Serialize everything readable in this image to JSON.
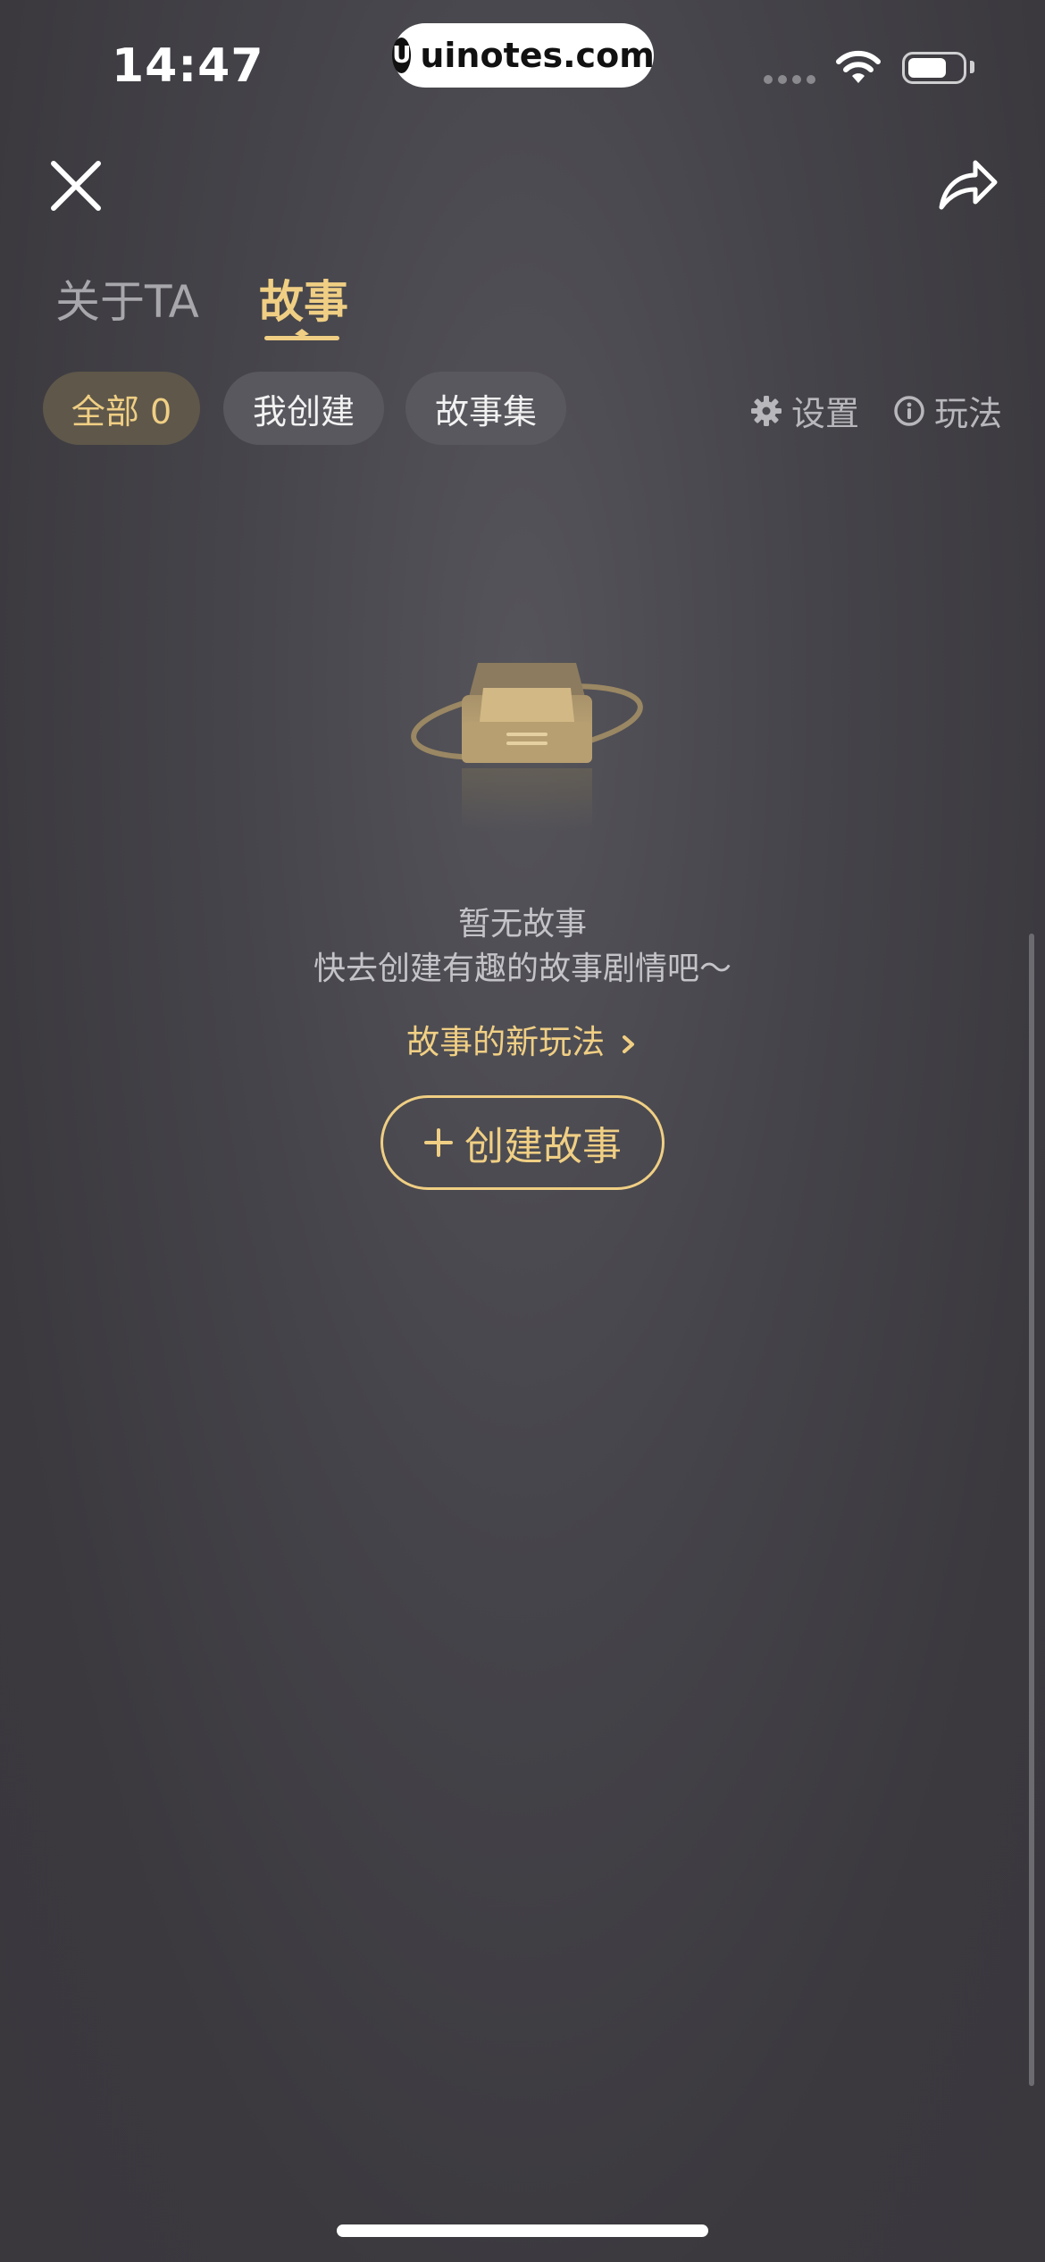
{
  "status_bar": {
    "time": "14:47",
    "watermark": "uinotes.com",
    "watermark_logo": "U",
    "battery_level": 0.72
  },
  "header": {
    "close_icon": "close-icon",
    "share_icon": "share-icon"
  },
  "tabs": [
    {
      "label": "关于TA",
      "active": false
    },
    {
      "label": "故事",
      "active": true
    }
  ],
  "filters": {
    "chips": [
      {
        "label": "全部 0",
        "active": true
      },
      {
        "label": "我创建",
        "active": false
      },
      {
        "label": "故事集",
        "active": false
      }
    ],
    "settings_label": "设置",
    "play_label": "玩法"
  },
  "empty_state": {
    "title": "暂无故事",
    "subtitle": "快去创建有趣的故事剧情吧～",
    "new_play_link": "故事的新玩法",
    "create_button": "创建故事"
  },
  "colors": {
    "accent": "#f0cf84",
    "background": "#45444a",
    "chip_bg": "#59585e"
  }
}
